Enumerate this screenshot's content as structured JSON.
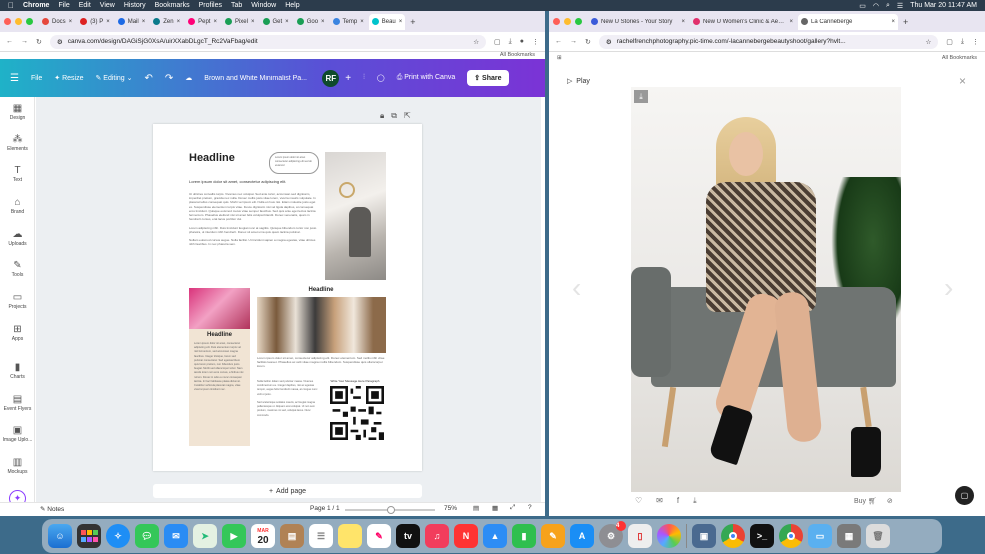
{
  "menubar": {
    "items": [
      "Chrome",
      "File",
      "Edit",
      "View",
      "History",
      "Bookmarks",
      "Profiles",
      "Tab",
      "Window",
      "Help"
    ],
    "clock": "Thu Mar 20  11:47 AM"
  },
  "left_window": {
    "tabs": [
      {
        "label": "Docs"
      },
      {
        "label": "(3) P"
      },
      {
        "label": "Mail"
      },
      {
        "label": "Zen"
      },
      {
        "label": "Pept"
      },
      {
        "label": "Pixel"
      },
      {
        "label": "Get"
      },
      {
        "label": "Goo"
      },
      {
        "label": "Temp"
      },
      {
        "label": "Beau"
      }
    ],
    "url": "canva.com/design/DAGiSjG0XsA/uirXXabDLgcT_Rc2VaFbag/edit",
    "all_bookmarks": "All Bookmarks",
    "toolbar": {
      "file": "File",
      "resize": "Resize",
      "editing": "Editing",
      "doc_title": "Brown and White Minimalist Pa...",
      "avatar_initials": "RF",
      "print": "Print with Canva",
      "share": "Share"
    },
    "sidebar": [
      "Design",
      "Elements",
      "Text",
      "Brand",
      "Uploads",
      "Tools",
      "Projects",
      "Apps",
      "Charts",
      "Event Flyers",
      "Image Uplo...",
      "Mockups"
    ],
    "page": {
      "headline_top": "Headline",
      "subtitle": "Lorem ipsum dolor sit amet, consectetur adipiscing elit.",
      "headline_mid": "Headline",
      "headline_left": "Headline",
      "qr_caption": "Write Your Message Here Paragraph"
    },
    "add_page": "Add page",
    "bottom": {
      "notes": "Notes",
      "page_counter": "Page 1 / 1",
      "zoom": "75%"
    }
  },
  "right_window": {
    "tabs": [
      {
        "label": "New U Stories - Your Story"
      },
      {
        "label": "New U Women's Clinic & Aesthe..."
      },
      {
        "label": "La Canneberge"
      }
    ],
    "url": "rachelfrenchphotography.pic-time.com/-lacannebergebeautyshoot/gallery?hvlt...",
    "all_bookmarks": "All Bookmarks",
    "play": "Play",
    "buy": "Buy"
  },
  "dock": {
    "calendar_month": "MAR",
    "calendar_day": "20",
    "badge": "4"
  }
}
